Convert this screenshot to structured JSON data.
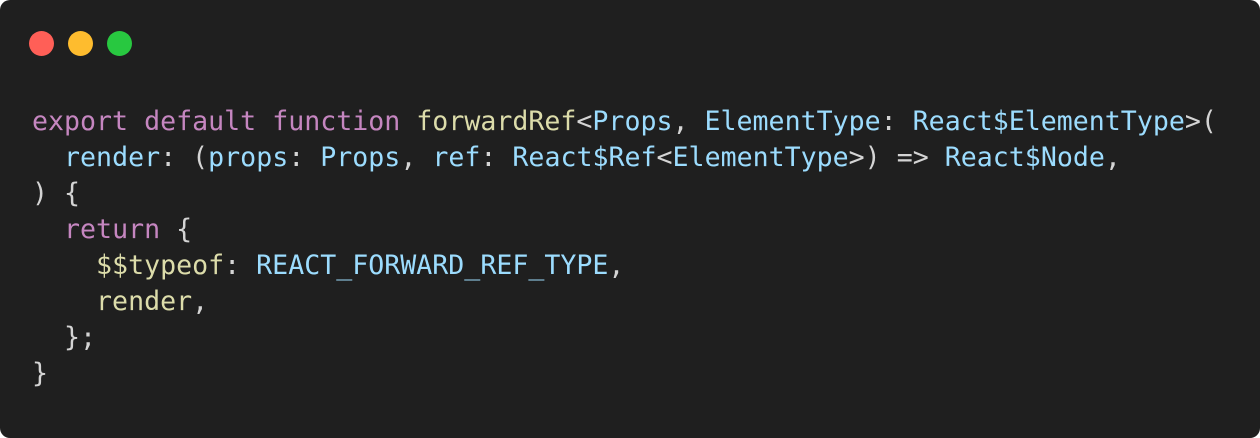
{
  "window": {
    "controls": [
      {
        "name": "close",
        "color": "#ff5f57"
      },
      {
        "name": "minimize",
        "color": "#febc2e"
      },
      {
        "name": "maximize",
        "color": "#28c840"
      }
    ]
  },
  "colors": {
    "background": "#1f1f1f",
    "plain": "#d4d4d4",
    "keyword": "#c586c0",
    "function": "#dcdcaa",
    "type": "#9cdcfe"
  },
  "code": {
    "lines": [
      [
        {
          "text": "export",
          "kind": "keyword"
        },
        {
          "text": " ",
          "kind": "plain"
        },
        {
          "text": "default",
          "kind": "keyword"
        },
        {
          "text": " ",
          "kind": "plain"
        },
        {
          "text": "function",
          "kind": "keyword"
        },
        {
          "text": " ",
          "kind": "plain"
        },
        {
          "text": "forwardRef",
          "kind": "function"
        },
        {
          "text": "<",
          "kind": "plain"
        },
        {
          "text": "Props",
          "kind": "type"
        },
        {
          "text": ", ",
          "kind": "plain"
        },
        {
          "text": "ElementType",
          "kind": "type"
        },
        {
          "text": ": ",
          "kind": "plain"
        },
        {
          "text": "React$ElementType",
          "kind": "type"
        },
        {
          "text": ">(",
          "kind": "plain"
        }
      ],
      [
        {
          "text": "  ",
          "kind": "plain"
        },
        {
          "text": "render",
          "kind": "type"
        },
        {
          "text": ": (",
          "kind": "plain"
        },
        {
          "text": "props",
          "kind": "type"
        },
        {
          "text": ": ",
          "kind": "plain"
        },
        {
          "text": "Props",
          "kind": "type"
        },
        {
          "text": ", ",
          "kind": "plain"
        },
        {
          "text": "ref",
          "kind": "type"
        },
        {
          "text": ": ",
          "kind": "plain"
        },
        {
          "text": "React$Ref",
          "kind": "type"
        },
        {
          "text": "<",
          "kind": "plain"
        },
        {
          "text": "ElementType",
          "kind": "type"
        },
        {
          "text": ">) => ",
          "kind": "plain"
        },
        {
          "text": "React$Node",
          "kind": "type"
        },
        {
          "text": ",",
          "kind": "plain"
        }
      ],
      [
        {
          "text": ") {",
          "kind": "plain"
        }
      ],
      [
        {
          "text": "  ",
          "kind": "plain"
        },
        {
          "text": "return",
          "kind": "keyword"
        },
        {
          "text": " {",
          "kind": "plain"
        }
      ],
      [
        {
          "text": "    ",
          "kind": "plain"
        },
        {
          "text": "$$typeof",
          "kind": "function"
        },
        {
          "text": ": ",
          "kind": "plain"
        },
        {
          "text": "REACT_FORWARD_REF_TYPE",
          "kind": "type"
        },
        {
          "text": ",",
          "kind": "plain"
        }
      ],
      [
        {
          "text": "    ",
          "kind": "plain"
        },
        {
          "text": "render",
          "kind": "function"
        },
        {
          "text": ",",
          "kind": "plain"
        }
      ],
      [
        {
          "text": "  };",
          "kind": "plain"
        }
      ],
      [
        {
          "text": "}",
          "kind": "plain"
        }
      ]
    ]
  }
}
